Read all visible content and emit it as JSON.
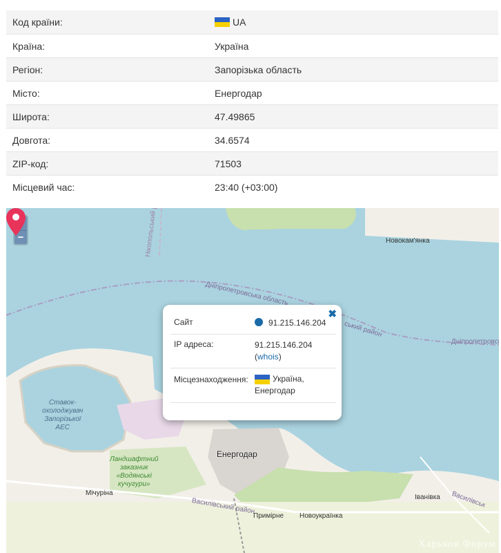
{
  "info_rows": [
    {
      "label": "Код країни:",
      "value": "UA",
      "flag": true
    },
    {
      "label": "Країна:",
      "value": "Україна",
      "flag": false
    },
    {
      "label": "Регіон:",
      "value": "Запорізька область",
      "flag": false
    },
    {
      "label": "Місто:",
      "value": "Енергодар",
      "flag": false
    },
    {
      "label": "Широта:",
      "value": "47.49865",
      "flag": false
    },
    {
      "label": "Довгота:",
      "value": "34.6574",
      "flag": false
    },
    {
      "label": "ZIP-код:",
      "value": "71503",
      "flag": false
    },
    {
      "label": "Місцевий час:",
      "value": "23:40 (+03:00)",
      "flag": false
    }
  ],
  "map": {
    "zoom_in": "+",
    "zoom_out": "−",
    "labels": {
      "nikopol_district": "Нікопольський район",
      "dnipro_oblast": "Дніпропетровська область",
      "district_fragment": "ський район",
      "dnipro_oblast_2": "Дніпропетровськ",
      "novokamianka": "Новокам'янка",
      "cooling_pond": "Ставок-\nохолоджувач\nЗапорізької\nАЕС",
      "reserve": "Ландшафтний\nзаказник\n«Водянські\nкучугури»",
      "enerhodar": "Енергодар",
      "michurino": "Мічуріна",
      "vasylivskyi_raion": "Василівський район",
      "prymirne": "Примірне",
      "novoukrainka": "Новоукраїнка",
      "ivanivka": "Іванівка",
      "vasylivskyi_2": "Василівськ"
    },
    "watermark": "Харьков Форум"
  },
  "popup": {
    "close": "✖",
    "site_label": "Сайт",
    "site_value": "91.215.146.204",
    "ip_label": "IP адреса:",
    "ip_value": "91.215.146.204",
    "whois_open": "(",
    "whois": "whois",
    "whois_close": ")",
    "location_label": "Місцезнаходження:",
    "location_country": "Україна,",
    "location_city": "Енергодар"
  },
  "colors": {
    "water": "#aad3df",
    "land": "#f2efe9",
    "green": "#c8dfae",
    "flag_blue": "#2b63c4",
    "flag_yellow": "#f5d000",
    "pin": "#e8335a",
    "link": "#1a6aa8"
  }
}
